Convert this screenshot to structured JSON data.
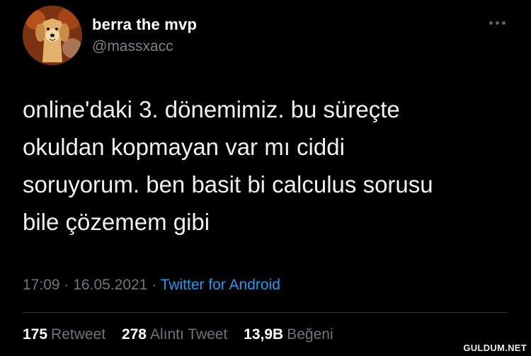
{
  "user": {
    "display_name": "berra the mvp",
    "handle": "@massxacc",
    "avatar_icon": "golden-retriever-avatar"
  },
  "tweet": {
    "lines": [
      "online'daki 3. dönemimiz. bu süreçte",
      "okuldan kopmayan var mı ciddi",
      "soruyorum. ben basit bi calculus sorusu",
      "bile çözemem gibi"
    ],
    "time": "17:09",
    "date": "16.05.2021",
    "separator": "·",
    "source": "Twitter for Android"
  },
  "stats": {
    "retweets": {
      "count": "175",
      "label": "Retweet"
    },
    "quotes": {
      "count": "278",
      "label": "Alıntı Tweet"
    },
    "likes": {
      "count": "13,9B",
      "label": "Beğeni"
    }
  },
  "watermark": "GULDUM.NET",
  "colors": {
    "background": "#000000",
    "text": "#e7e9ea",
    "secondary": "#6e767d",
    "link": "#1d9bf0",
    "divider": "#2f3336"
  }
}
